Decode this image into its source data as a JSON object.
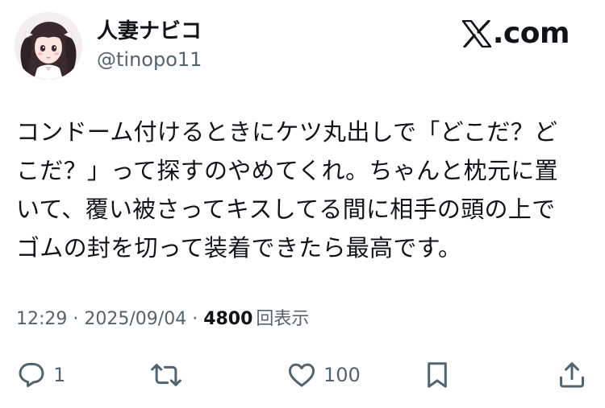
{
  "author": {
    "display_name": "人妻ナビコ",
    "handle": "@tinopo11"
  },
  "brand": {
    "logo_icon": "x-logo-icon",
    "text": ".com"
  },
  "tweet": {
    "lines": [
      "コンドーム付けるときにケツ丸出しで「どこだ？ど",
      "こだ？」って探すのやめてくれ。ちゃんと枕元に置",
      "いて、覆い被さってキスしてる間に相手の頭の上で",
      "ゴムの封を切って装着できたら最高です。"
    ]
  },
  "meta": {
    "time": "12:29",
    "separator": " · ",
    "date": "2025/09/04",
    "views_count": "4800",
    "views_label": "回表示"
  },
  "actions": {
    "reply": {
      "icon": "reply-icon",
      "count": "1"
    },
    "repost": {
      "icon": "repost-icon",
      "count": ""
    },
    "like": {
      "icon": "heart-icon",
      "count": "100"
    },
    "bookmark": {
      "icon": "bookmark-icon",
      "count": ""
    },
    "share": {
      "icon": "share-icon",
      "count": ""
    }
  },
  "colors": {
    "text_primary": "#0f1419",
    "text_secondary": "#536471",
    "background": "#ffffff"
  }
}
